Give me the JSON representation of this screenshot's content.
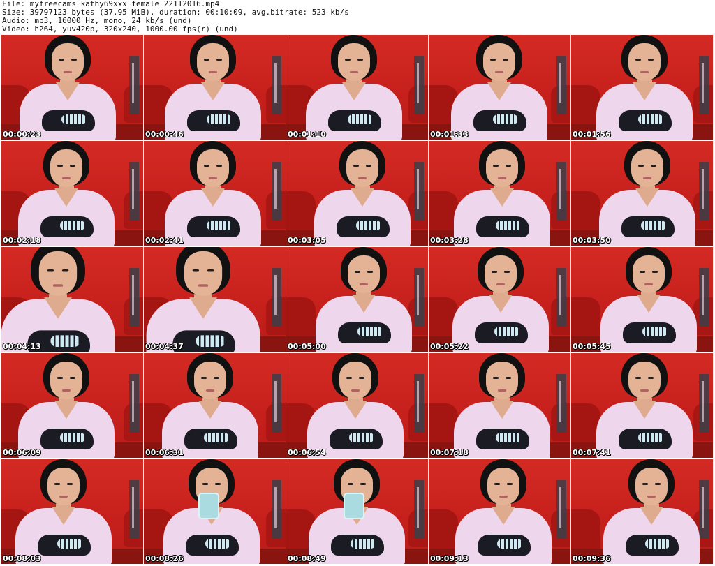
{
  "header": {
    "file_line": "File: myfreecams_kathy69xxx_female_22112016.mp4",
    "size_line": "Size: 39797123 bytes (37.95 MiB), duration: 00:10:09, avg.bitrate: 523 kb/s",
    "audio_line": "Audio: mp3, 16000 Hz, mono, 24 kb/s (und)",
    "video_line": "Video: h264, yuv420p, 320x240, 1000.00 fps(r) (und)"
  },
  "thumbnails": [
    {
      "timestamp": "00:00:23"
    },
    {
      "timestamp": "00:00:46"
    },
    {
      "timestamp": "00:01:10"
    },
    {
      "timestamp": "00:01:33"
    },
    {
      "timestamp": "00:01:56"
    },
    {
      "timestamp": "00:02:18"
    },
    {
      "timestamp": "00:02:41"
    },
    {
      "timestamp": "00:03:05"
    },
    {
      "timestamp": "00:03:28"
    },
    {
      "timestamp": "00:03:50"
    },
    {
      "timestamp": "00:04:13"
    },
    {
      "timestamp": "00:04:37"
    },
    {
      "timestamp": "00:05:00"
    },
    {
      "timestamp": "00:05:22"
    },
    {
      "timestamp": "00:05:45"
    },
    {
      "timestamp": "00:06:09"
    },
    {
      "timestamp": "00:06:31"
    },
    {
      "timestamp": "00:06:54"
    },
    {
      "timestamp": "00:07:18"
    },
    {
      "timestamp": "00:07:41"
    },
    {
      "timestamp": "00:08:03"
    },
    {
      "timestamp": "00:08:26"
    },
    {
      "timestamp": "00:08:49"
    },
    {
      "timestamp": "00:09:13"
    },
    {
      "timestamp": "00:09:36"
    }
  ],
  "colors": {
    "background": "#ffffff",
    "header_text": "#111111",
    "timestamp_text": "#ffffff",
    "wall_red": "#c8211e",
    "shirt_pink": "#eed7ec",
    "hair_black": "#111111"
  }
}
